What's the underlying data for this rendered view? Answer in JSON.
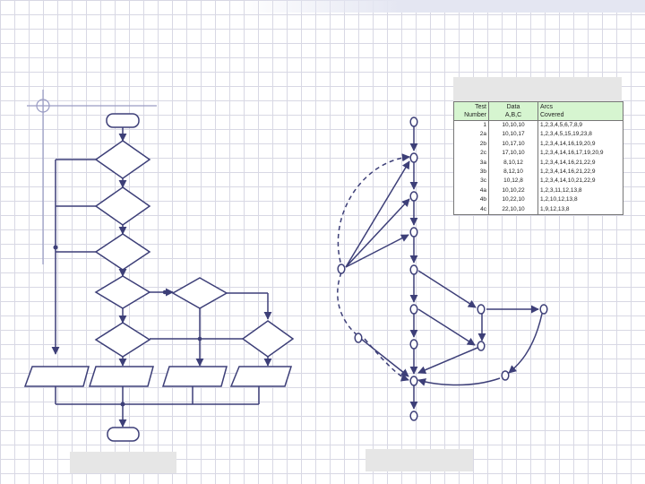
{
  "colors": {
    "stroke": "#3d3f78",
    "grid": "#d8d8e4",
    "table_header_bg": "#d6f5d0",
    "caption_box": "#e6e6e6"
  },
  "test_table": {
    "header": {
      "test_line1": "Test",
      "test_line2": "Number",
      "data_line1": "Data",
      "data_line2": "A,B,C",
      "arcs_line1": "Arcs",
      "arcs_line2": "Covered"
    },
    "rows": [
      {
        "test": "1",
        "data": "10,10,10",
        "arcs": "1,2,3,4,5,6,7,8,9"
      },
      {
        "test": "2a",
        "data": "10,10,17",
        "arcs": "1,2,3,4,5,15,19,23,8"
      },
      {
        "test": "2b",
        "data": "10,17,10",
        "arcs": "1,2,3,4,14,16,19,20,9"
      },
      {
        "test": "2c",
        "data": "17,10,10",
        "arcs": "1,2,3,4,14,16,17,19,20,9"
      },
      {
        "test": "3a",
        "data": "8,10,12",
        "arcs": "1,2,3,4,14,16,21,22,9"
      },
      {
        "test": "3b",
        "data": "8,12,10",
        "arcs": "1,2,3,4,14,16,21,22,9"
      },
      {
        "test": "3c",
        "data": "10,12,8",
        "arcs": "1,2,3,4,14,10,21,22,9"
      },
      {
        "test": "4a",
        "data": "10,10,22",
        "arcs": "1,2,3,11,12,13,8"
      },
      {
        "test": "4b",
        "data": "10,22,10",
        "arcs": "1,2,10,12,13,8"
      },
      {
        "test": "4c",
        "data": "22,10,10",
        "arcs": "1,9,12,13,8"
      }
    ]
  }
}
